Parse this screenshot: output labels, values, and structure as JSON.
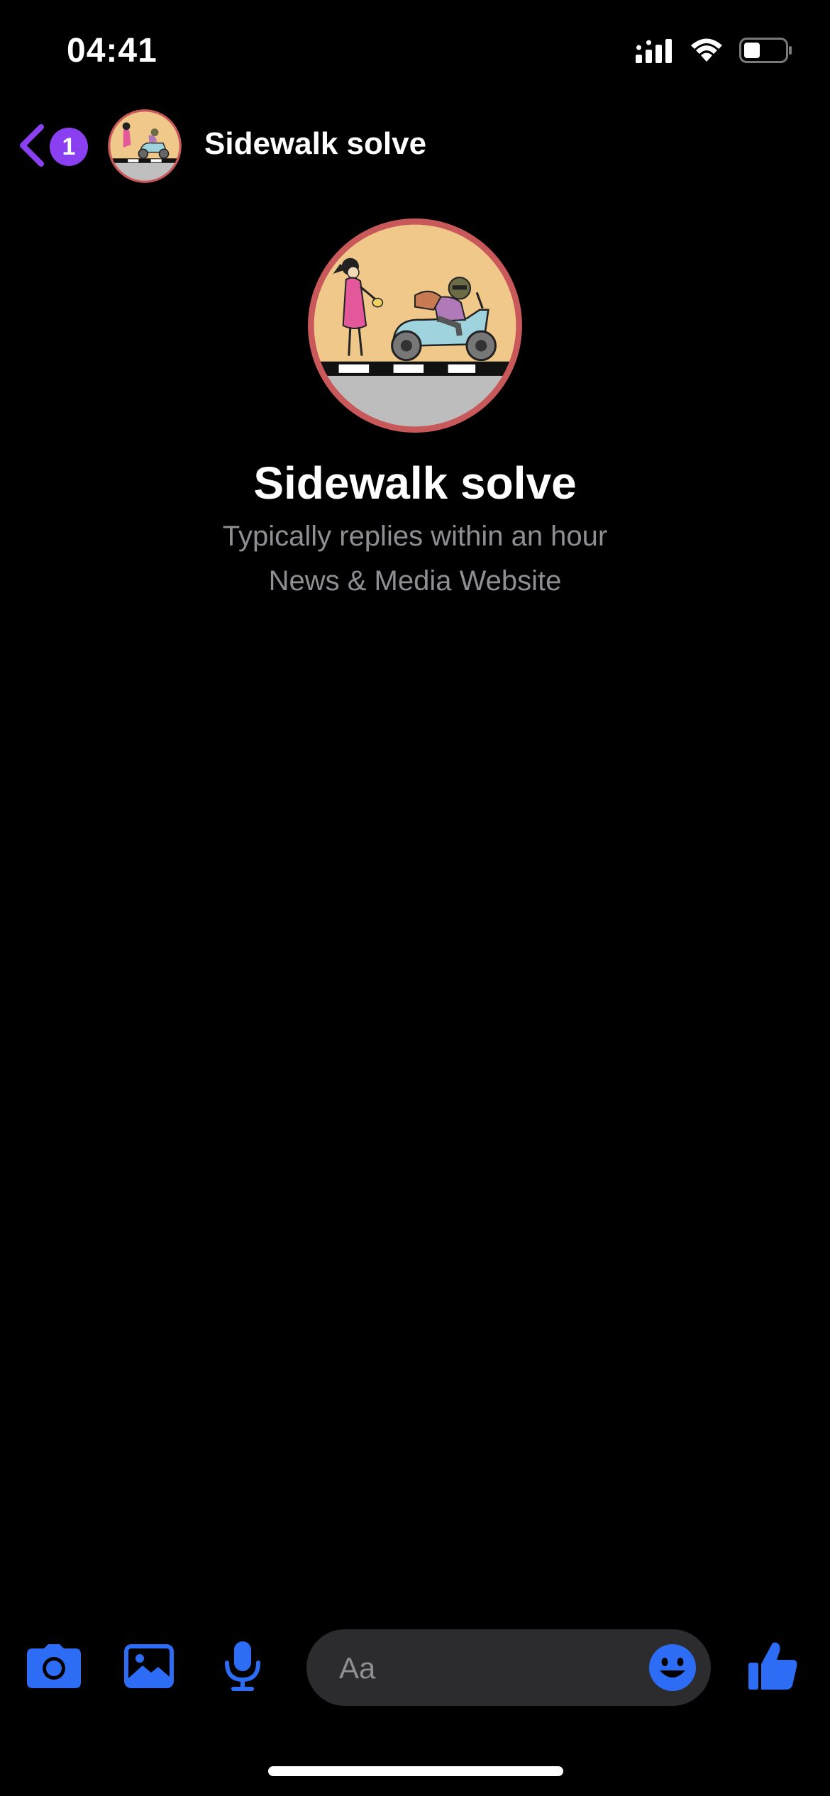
{
  "status_bar": {
    "time": "04:41",
    "icons": [
      "cellular-signal-icon",
      "wifi-icon",
      "battery-icon"
    ]
  },
  "header": {
    "back_icon": "chevron-left-icon",
    "unread_count": "1",
    "title": "Sidewalk solve"
  },
  "profile": {
    "name": "Sidewalk solve",
    "response_time": "Typically replies within an hour",
    "category": "News & Media Website"
  },
  "composer": {
    "placeholder": "Aa",
    "icons": [
      "camera-icon",
      "photo-gallery-icon",
      "microphone-icon",
      "emoji-icon",
      "thumbs-up-icon"
    ]
  },
  "colors": {
    "background": "#000000",
    "accent_purple": "#8a3ff0",
    "accent_blue": "#2d6df6",
    "secondary_text": "#8e8e93",
    "input_bg": "#2c2c2e",
    "avatar_bg": "#f0c98a",
    "avatar_ring": "#c8585a"
  }
}
